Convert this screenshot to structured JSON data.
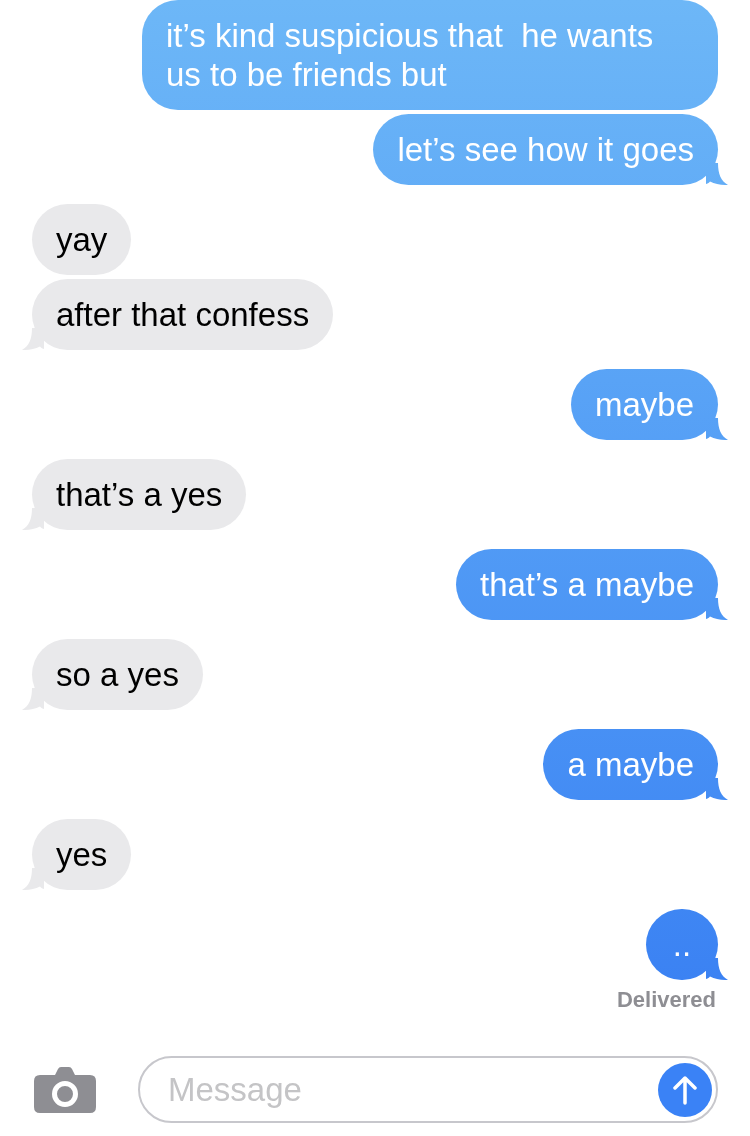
{
  "messages": [
    {
      "kind": "sent",
      "text": "it’s kind suspicious that  he wants us to be friends but"
    },
    {
      "kind": "sent",
      "text": "let’s see how it goes"
    },
    {
      "kind": "received",
      "text": "yay"
    },
    {
      "kind": "received",
      "text": "after that confess"
    },
    {
      "kind": "sent",
      "text": "maybe"
    },
    {
      "kind": "received",
      "text": "that’s a yes"
    },
    {
      "kind": "sent",
      "text": "that’s a maybe"
    },
    {
      "kind": "received",
      "text": "so a yes"
    },
    {
      "kind": "sent",
      "text": "a maybe"
    },
    {
      "kind": "received",
      "text": "yes"
    },
    {
      "kind": "sent",
      "text": ".."
    }
  ],
  "status": "Delivered",
  "composer": {
    "placeholder": "Message"
  }
}
